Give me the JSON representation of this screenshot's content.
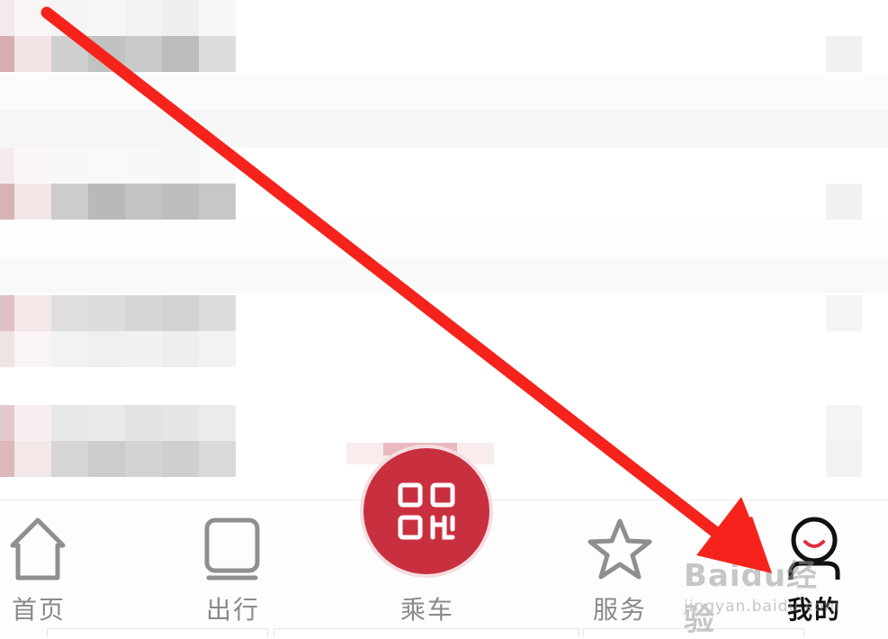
{
  "tabbar": {
    "items": [
      {
        "id": "home",
        "label": "首页",
        "icon": "home-icon",
        "active": false
      },
      {
        "id": "travel",
        "label": "出行",
        "icon": "tablet-icon",
        "active": false
      },
      {
        "id": "ride",
        "label": "乘车",
        "icon": "qr-code-icon",
        "active": false
      },
      {
        "id": "services",
        "label": "服务",
        "icon": "star-icon",
        "active": false
      },
      {
        "id": "mine",
        "label": "我的",
        "icon": "user-icon",
        "active": true
      }
    ]
  },
  "watermark": {
    "title": "Baidu经验",
    "url": "jingyan.baidu.com"
  },
  "colors": {
    "accent": "#c9303f",
    "arrow": "#f5231c",
    "inactive": "#8a8a8a",
    "active": "#111111"
  }
}
